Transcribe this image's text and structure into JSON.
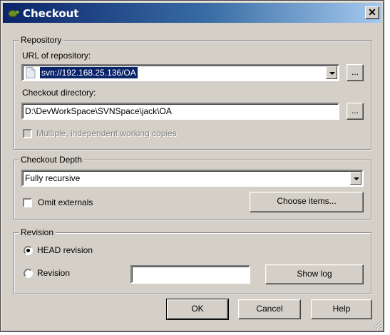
{
  "window": {
    "title": "Checkout",
    "close_label": "✕"
  },
  "repository": {
    "legend": "Repository",
    "url_label": "URL of repository:",
    "url_value": "svn://192.168.25.136/OA",
    "url_browse": "...",
    "dir_label": "Checkout directory:",
    "dir_value": "D:\\DevWorkSpace\\SVNSpace\\jack\\OA",
    "dir_browse": "...",
    "multiple_label": "Multiple, independent working copies",
    "multiple_checked": false
  },
  "depth": {
    "legend": "Checkout Depth",
    "depth_value": "Fully recursive",
    "omit_label": "Omit externals",
    "omit_checked": false,
    "choose_label": "Choose items..."
  },
  "revision": {
    "legend": "Revision",
    "head_label": "HEAD revision",
    "rev_label": "Revision",
    "rev_value": "",
    "showlog_label": "Show log",
    "selected": "head"
  },
  "buttons": {
    "ok": "OK",
    "cancel": "Cancel",
    "help": "Help"
  },
  "colors": {
    "title_start": "#0a246a",
    "title_end": "#a6caf0",
    "face": "#d4d0c8",
    "selection": "#0a246a"
  }
}
